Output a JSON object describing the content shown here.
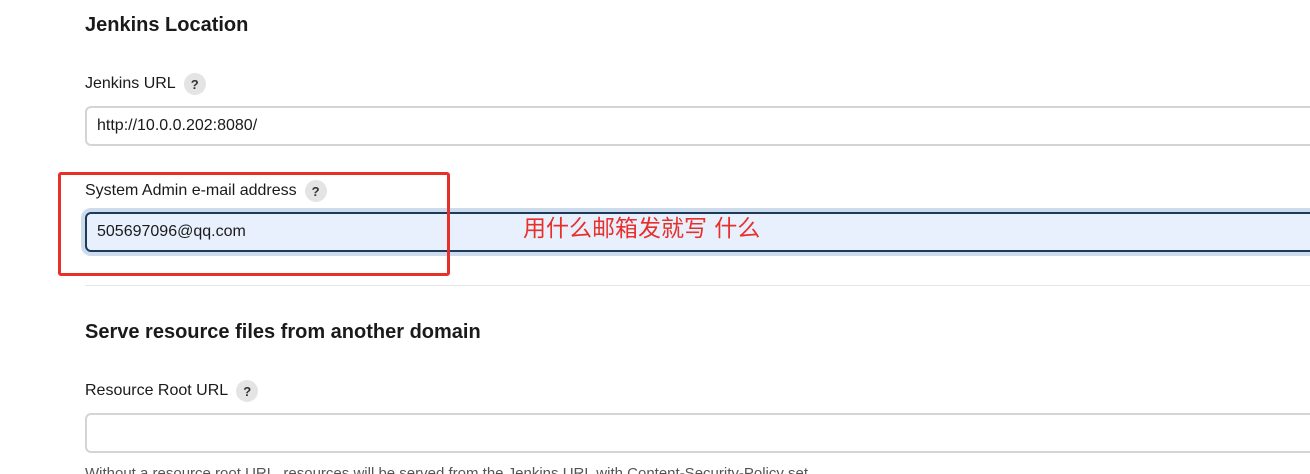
{
  "jenkins_location": {
    "title": "Jenkins Location",
    "url_field": {
      "label": "Jenkins URL",
      "help": "?",
      "value": "http://10.0.0.202:8080/"
    },
    "email_field": {
      "label": "System Admin e-mail address",
      "help": "?",
      "value": "505697096@qq.com"
    }
  },
  "annotation": {
    "text": "用什么邮箱发就写 什么",
    "color": "#e8302a"
  },
  "resource_domain": {
    "title": "Serve resource files from another domain",
    "root_url_field": {
      "label": "Resource Root URL",
      "help": "?",
      "value": ""
    },
    "description_partial": "Without a resource root URL, resources will be served from the Jenkins URL with Content-Security-Policy set."
  },
  "colors": {
    "focus_border": "#1b3a5c",
    "focus_background": "#e8f0fe",
    "input_border": "#d4d4d8",
    "help_background": "#e4e4e4"
  }
}
